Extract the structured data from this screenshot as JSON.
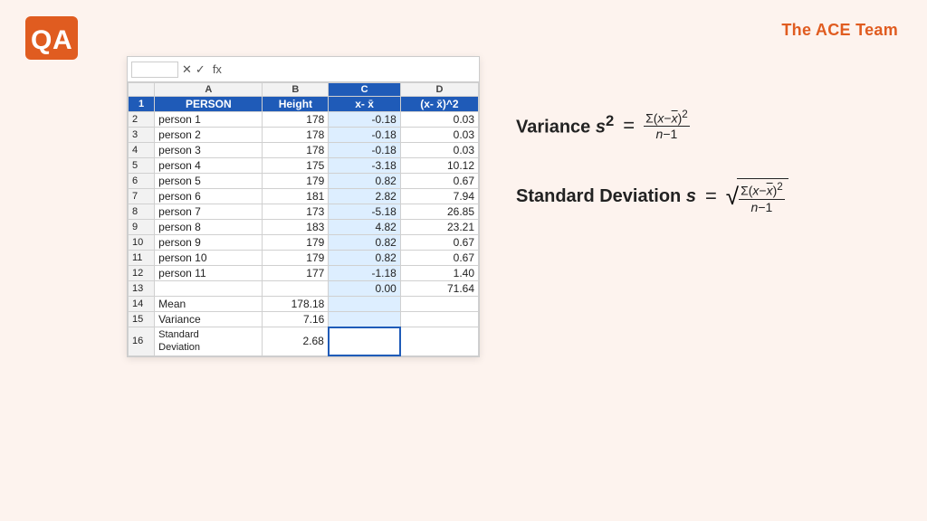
{
  "brand": {
    "name": "The ACE Team",
    "logo_text": "QA"
  },
  "spreadsheet": {
    "cell_ref": "C16",
    "columns": [
      "A",
      "B",
      "C",
      "D"
    ],
    "col_widths": [
      "90px",
      "55px",
      "60px",
      "65px"
    ],
    "headers": [
      "PERSON",
      "Height",
      "x- x̄",
      "(x- x̄)^2"
    ],
    "rows": [
      [
        "person 1",
        "178",
        "-0.18",
        "0.03"
      ],
      [
        "person 2",
        "178",
        "-0.18",
        "0.03"
      ],
      [
        "person 3",
        "178",
        "-0.18",
        "0.03"
      ],
      [
        "person 4",
        "175",
        "-3.18",
        "10.12"
      ],
      [
        "person 5",
        "179",
        "0.82",
        "0.67"
      ],
      [
        "person 6",
        "181",
        "2.82",
        "7.94"
      ],
      [
        "person 7",
        "173",
        "-5.18",
        "26.85"
      ],
      [
        "person 8",
        "183",
        "4.82",
        "23.21"
      ],
      [
        "person 9",
        "179",
        "0.82",
        "0.67"
      ],
      [
        "person 10",
        "179",
        "0.82",
        "0.67"
      ],
      [
        "person 11",
        "177",
        "-1.18",
        "1.40"
      ]
    ],
    "empty_row": [
      "",
      "",
      "0.00",
      "71.64"
    ],
    "summary": [
      {
        "label": "Mean",
        "value": "178.18"
      },
      {
        "label": "Variance",
        "value": "7.16"
      },
      {
        "label": "Standard\nDeviation",
        "value": "2.68"
      }
    ]
  },
  "formulas": {
    "variance": {
      "label": "Variance",
      "var": "s²",
      "eq": "=",
      "numerator": "Σ(x−x̄)²",
      "denominator": "n−1"
    },
    "stddev": {
      "label": "Standard Deviation",
      "var": "s",
      "eq": "=",
      "numerator": "Σ(x−x̄)²",
      "denominator": "n−1"
    }
  }
}
